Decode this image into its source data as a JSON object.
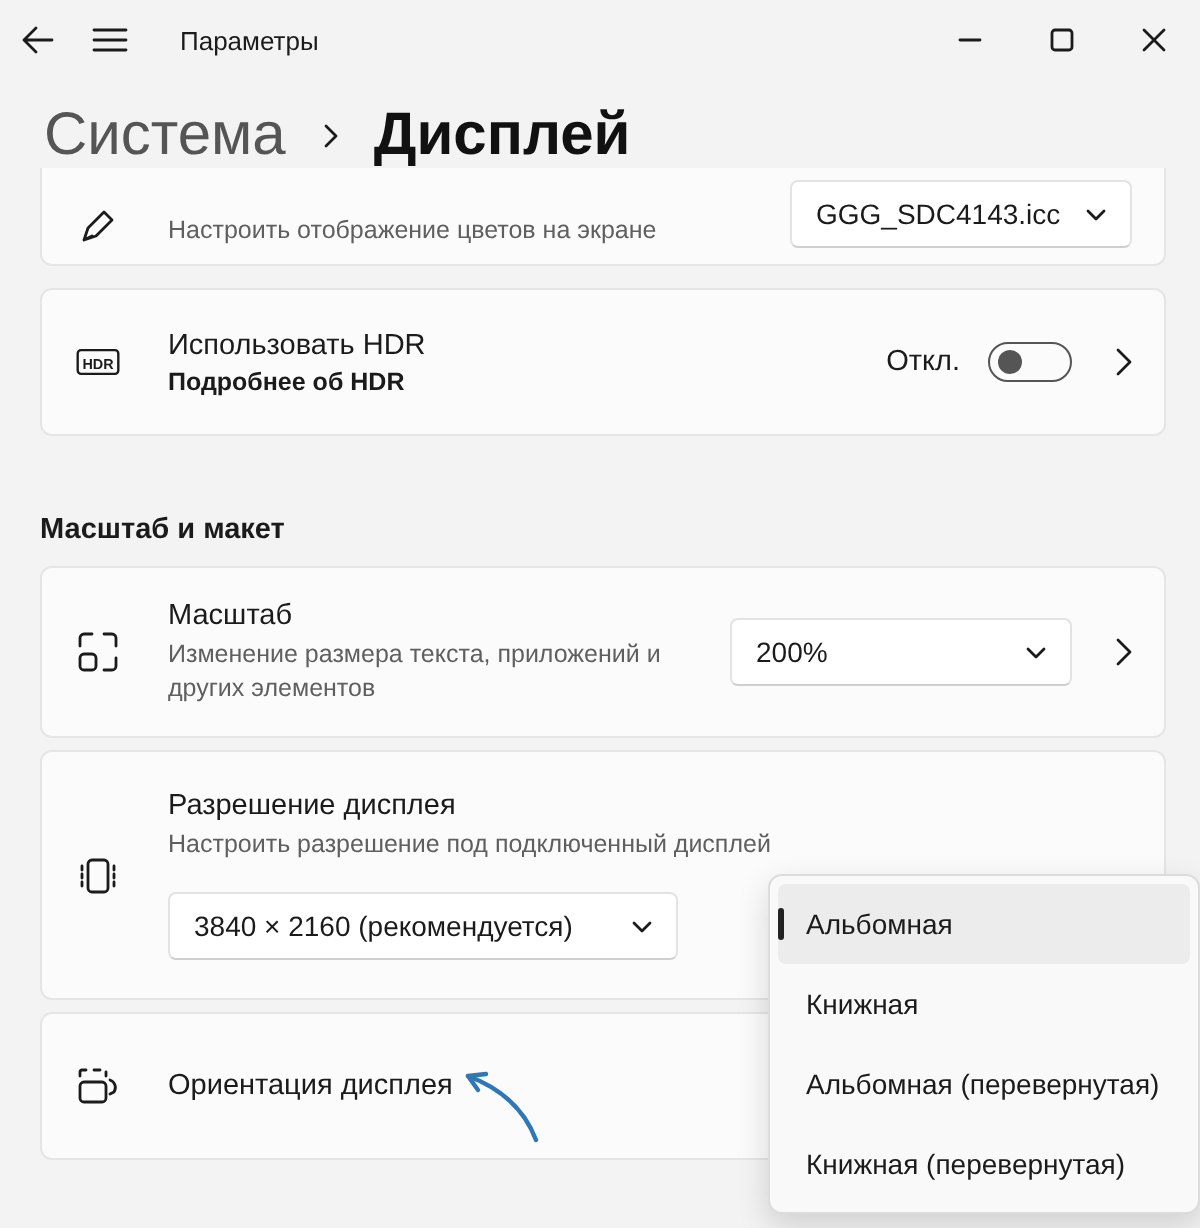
{
  "window": {
    "title": "Параметры"
  },
  "breadcrumb": [
    {
      "label": "Система",
      "current": false
    },
    {
      "label": "Дисплей",
      "current": true
    }
  ],
  "cards": [
    {
      "kind": "select",
      "description": "Настроить отображение цветов на экране",
      "value": "GGG_SDC4143.icc",
      "chevron": false
    },
    {
      "kind": "toggle",
      "badge": "HDR",
      "title": "Использовать HDR",
      "link": "Подробнее об HDR",
      "state_label": "Откл.",
      "on": false,
      "chevron": true
    }
  ],
  "section": {
    "title": "Масштаб и макет",
    "cards": [
      {
        "kind": "select",
        "title": "Масштаб",
        "description": "Изменение размера текста, приложений и других элементов",
        "value": "200%",
        "chevron": true
      },
      {
        "kind": "resolution",
        "title": "Разрешение дисплея",
        "description": "Настроить разрешение под подключенный дисплей",
        "value": "3840 × 2160 (рекомендуется)"
      },
      {
        "kind": "plain",
        "title": "Ориентация дисплея"
      }
    ]
  },
  "orientation_menu": {
    "items": [
      {
        "label": "Альбомная",
        "selected": true
      },
      {
        "label": "Книжная",
        "selected": false
      },
      {
        "label": "Альбомная (перевернутая)",
        "selected": false
      },
      {
        "label": "Книжная (перевернутая)",
        "selected": false
      }
    ]
  }
}
